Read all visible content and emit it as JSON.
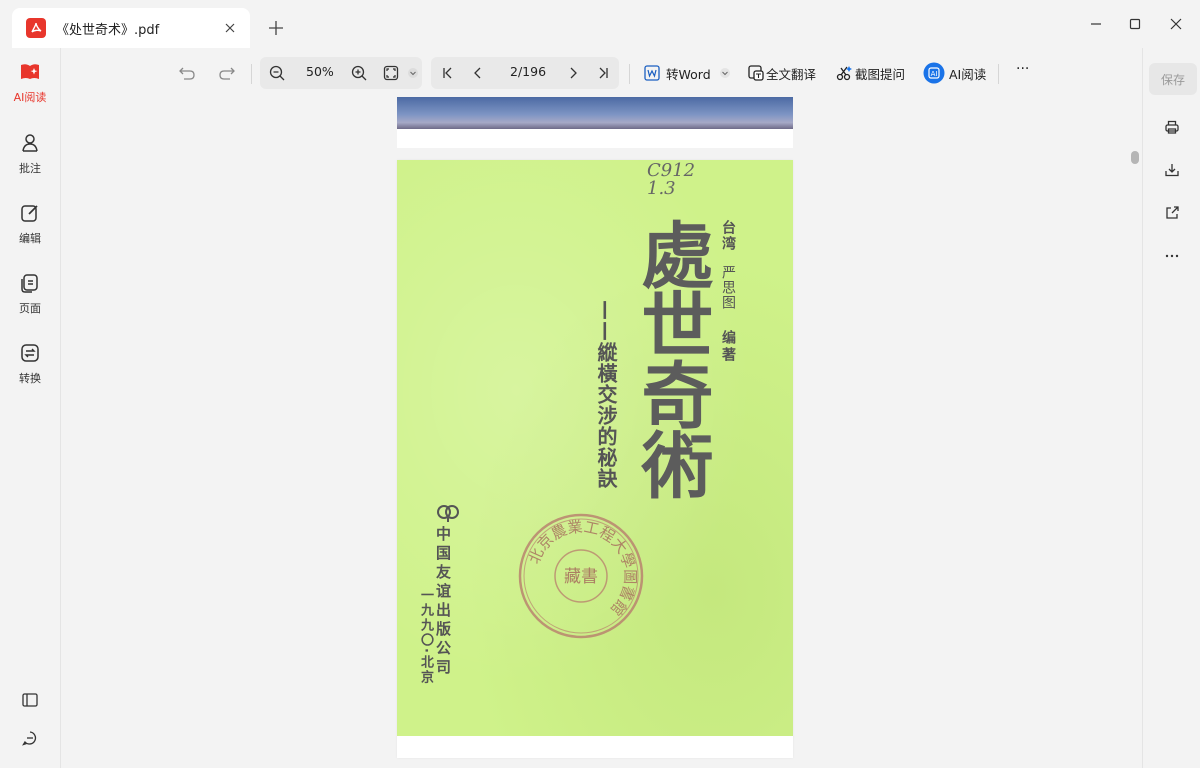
{
  "tab": {
    "title": "《处世奇术》.pdf",
    "icon": "pdf-icon"
  },
  "window": {
    "controls": [
      "minimize-icon",
      "maximize-icon",
      "close-icon"
    ]
  },
  "leftnav": {
    "items": [
      {
        "label": "AI阅读",
        "icon": "ai-read-icon",
        "active": true
      },
      {
        "label": "批注",
        "icon": "annotate-icon"
      },
      {
        "label": "编辑",
        "icon": "edit-icon"
      },
      {
        "label": "页面",
        "icon": "pages-icon"
      },
      {
        "label": "转换",
        "icon": "convert-icon"
      }
    ],
    "bottom": [
      "sidebar-toggle-icon",
      "chat-icon"
    ]
  },
  "toolbar": {
    "zoom": "50%",
    "page_indicator": "2/196",
    "to_word": "转Word",
    "full_translate": "全文翻译",
    "screenshot_ask": "截图提问",
    "ai_read": "AI阅读",
    "more": "···"
  },
  "rightpanel": {
    "save": "保存",
    "icons": [
      "print-icon",
      "download-icon",
      "share-icon",
      "more-icon"
    ]
  },
  "document": {
    "handwritten": "C912\n1.3",
    "title": "處世奇術",
    "subtitle": "——縱橫交涉的秘訣",
    "author_origin": "台湾",
    "author_name": "严思图",
    "author_role": "编著",
    "publisher": "中国友谊出版公司",
    "pub_date": "一九九〇·北京",
    "seal_outer": "北京農業工程大學圖書館",
    "seal_inner": "藏書",
    "cover_color": "#cff28a"
  },
  "colors": {
    "accent": "#e8362c",
    "ai_blue": "#1a73e8"
  }
}
